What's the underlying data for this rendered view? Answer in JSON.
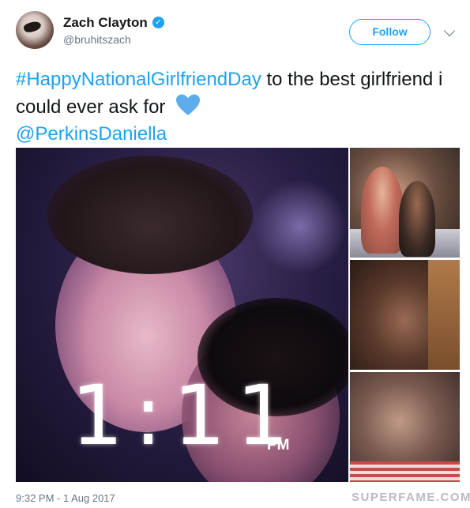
{
  "author": {
    "display_name": "Zach Clayton",
    "handle": "@bruhitszach",
    "verified": true,
    "avatar_icon": "profile-avatar"
  },
  "follow_button": {
    "label": "Follow"
  },
  "menu": {
    "icon": "chevron-down-icon"
  },
  "tweet": {
    "hashtag": "#HappyNationalGirlfriendDay",
    "text": " to the best girlfriend i could ever ask for ",
    "emoji": "blue-heart",
    "mention": "@PerkinsDaniella"
  },
  "media": {
    "main_overlay_time": "1:11",
    "main_overlay_period": "PM"
  },
  "timestamp": "9:32 PM - 1 Aug 2017",
  "watermark": "SUPERFAME.COM",
  "colors": {
    "link": "#1da1f2",
    "text": "#14171a",
    "muted": "#657786"
  }
}
